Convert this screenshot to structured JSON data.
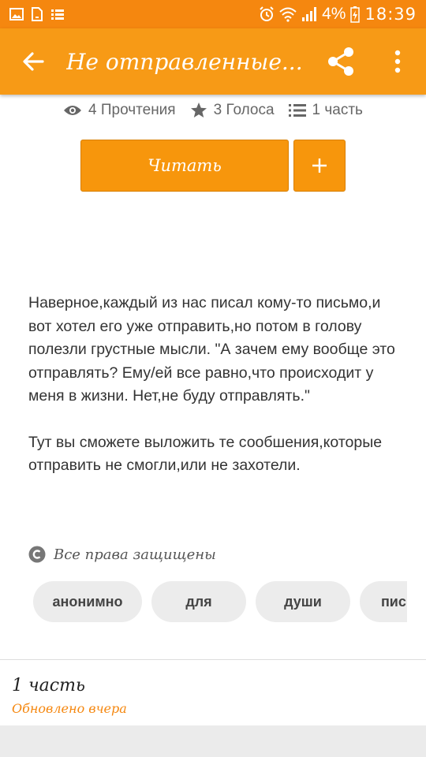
{
  "status_bar": {
    "battery": "4%",
    "time": "18:39"
  },
  "app_bar": {
    "title": "Не отправленные..."
  },
  "stats": {
    "reads": "4 Прочтения",
    "votes": "3 Голоса",
    "parts": "1 часть"
  },
  "actions": {
    "read_label": "Читать",
    "add_label": "+"
  },
  "description": {
    "paragraph1": "Наверное,каждый из нас писал кому-то письмо,и вот хотел его уже отправить,но потом в голову полезли грустные мысли. \"А зачем ему вообще это отправлять? Ему/ей все равно,что происходит у меня в жизни. Нет,не буду отправлять.\"",
    "paragraph2": "Тут вы сможете выложить те сообшения,которые отправить не смогли,или не захотели."
  },
  "copyright": {
    "label": "Все права защищены"
  },
  "tags": [
    {
      "label": "анонимно"
    },
    {
      "label": "для"
    },
    {
      "label": "души"
    },
    {
      "label": "письма"
    }
  ],
  "parts_list": {
    "item_title": "1 часть",
    "item_updated": "Обновлено вчера"
  },
  "colors": {
    "accent": "#f79a16",
    "status_bar": "#f5870f",
    "button": "#f7960c"
  }
}
